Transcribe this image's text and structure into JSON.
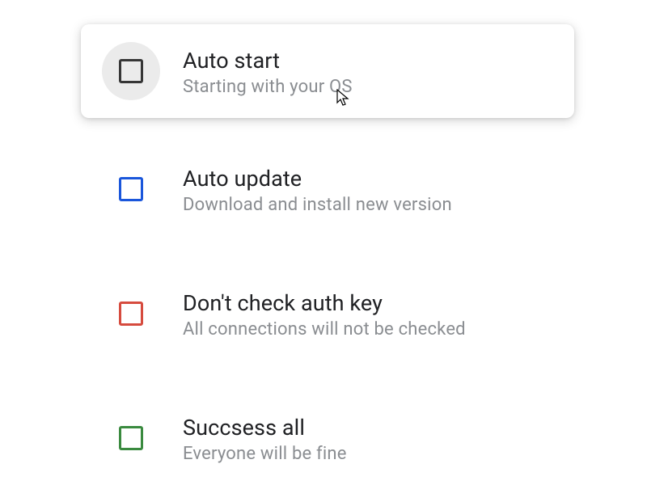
{
  "options": [
    {
      "title": "Auto start",
      "subtitle": "Starting with your OS",
      "color": "#363636",
      "hovered": true
    },
    {
      "title": "Auto update",
      "subtitle": "Download and install new version",
      "color": "#1a56db",
      "hovered": false
    },
    {
      "title": "Don't check auth key",
      "subtitle": "All connections will not be checked",
      "color": "#d64b3e",
      "hovered": false
    },
    {
      "title": "Succsess all",
      "subtitle": "Everyone will be fine",
      "color": "#3a8a3f",
      "hovered": false
    }
  ]
}
